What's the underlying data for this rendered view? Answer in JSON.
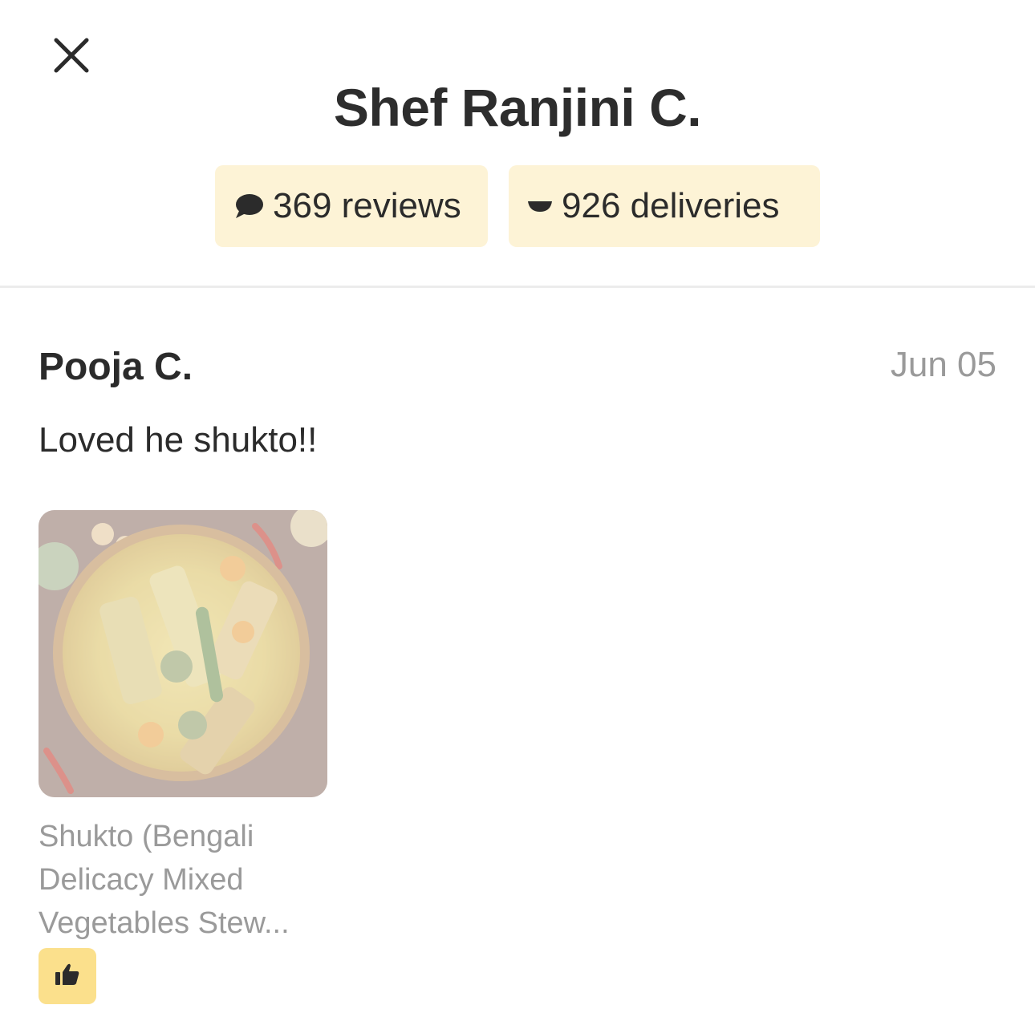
{
  "header": {
    "title": "Shef Ranjini C.",
    "close_icon": "close-icon"
  },
  "stats": {
    "reviews_label": "369 reviews",
    "reviews_icon": "chat-bubble-icon",
    "deliveries_label": "926 deliveries",
    "deliveries_icon": "bowl-icon",
    "pill_color": "#fdf3d6"
  },
  "review": {
    "reviewer": "Pooja C.",
    "date": "Jun 05",
    "text": "Loved he shukto!!",
    "dish": {
      "image_icon": "dish-photo",
      "name": "Shukto (Bengali Delicacy Mixed Vegetables Stew..."
    },
    "like_icon": "thumbs-up-icon",
    "like_button_color": "#fbe08c"
  }
}
